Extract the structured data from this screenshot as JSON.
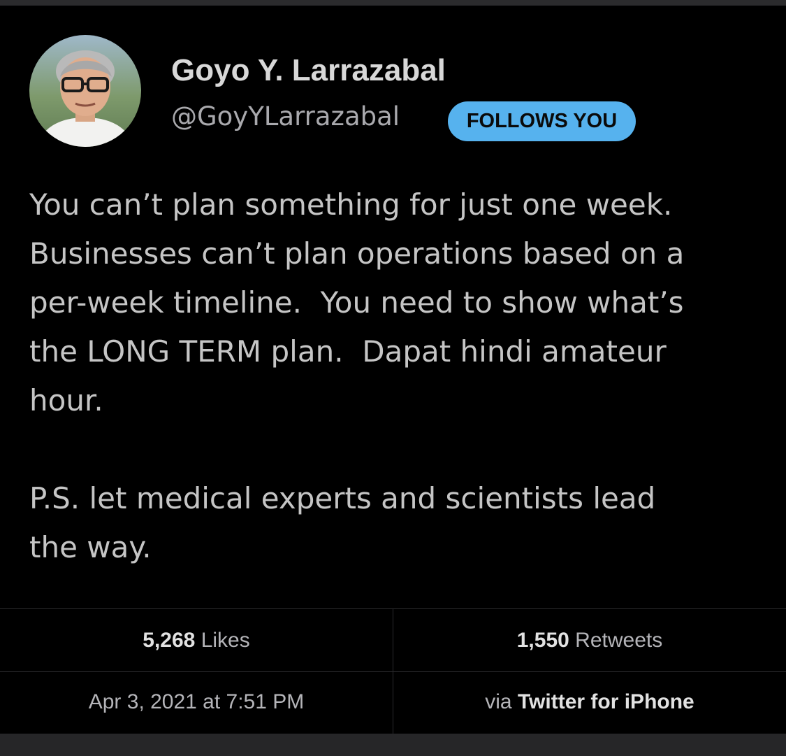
{
  "author": {
    "display_name": "Goyo Y. Larrazabal",
    "handle": "@GoyYLarrazabal",
    "follows_badge": "FOLLOWS YOU"
  },
  "tweet": {
    "paragraphs": [
      [
        "You can’t plan something for just one week.",
        "Businesses can’t plan operations based on a",
        "per-week timeline.  You need to show what’s",
        "the LONG TERM plan.  Dapat hindi amateur",
        "hour."
      ],
      [
        "P.S. let medical experts and scientists lead",
        "the way."
      ]
    ]
  },
  "stats": {
    "likes_count": "5,268",
    "likes_label": "Likes",
    "retweets_count": "1,550",
    "retweets_label": "Retweets"
  },
  "meta": {
    "timestamp": "Apr 3, 2021 at 7:51 PM",
    "via_label": "via",
    "source": "Twitter for iPhone"
  },
  "colors": {
    "background": "#000000",
    "badge": "#56b2ee",
    "text_primary": "#d8d8d8",
    "text_secondary": "#a9a9ad"
  }
}
